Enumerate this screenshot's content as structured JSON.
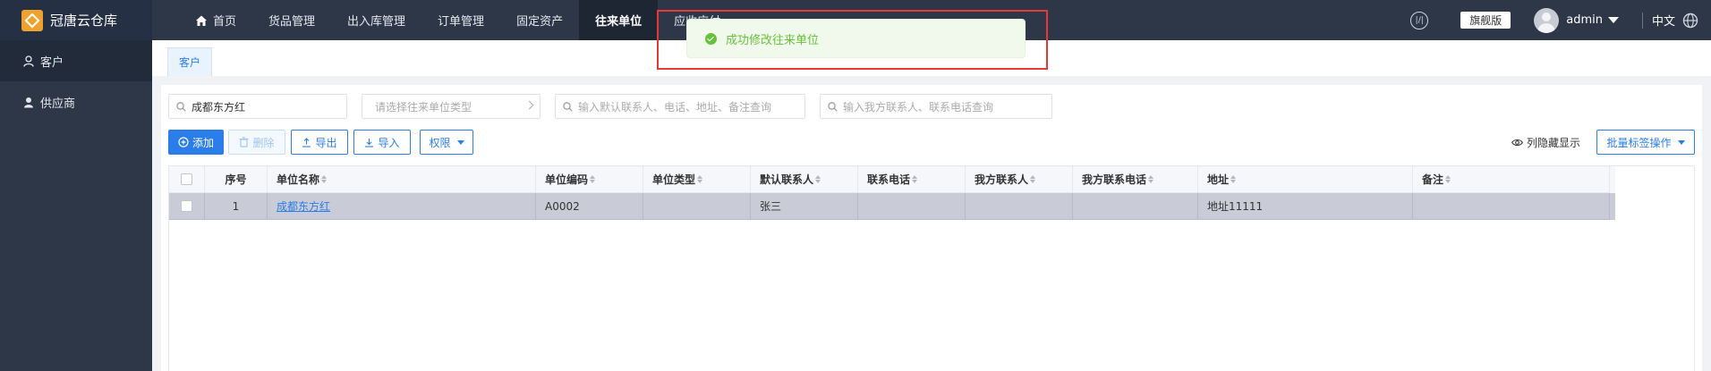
{
  "app": {
    "title": "冠唐云仓库"
  },
  "nav": {
    "items": [
      {
        "label": "首页",
        "icon": "home-icon"
      },
      {
        "label": "货品管理"
      },
      {
        "label": "出入库管理"
      },
      {
        "label": "订单管理"
      },
      {
        "label": "固定资产"
      },
      {
        "label": "往来单位",
        "active": true
      },
      {
        "label": "应收应付"
      }
    ]
  },
  "header": {
    "edition_badge": "旗舰版",
    "user_name": "admin",
    "language": "中文"
  },
  "sidebar": {
    "items": [
      {
        "label": "客户",
        "icon": "user-icon",
        "active": true
      },
      {
        "label": "供应商",
        "icon": "user-solid-icon"
      }
    ]
  },
  "tabs": [
    {
      "label": "客户"
    }
  ],
  "filters": {
    "name_value": "成都东方红",
    "type_placeholder": "请选择往来单位类型",
    "contact_placeholder": "输入默认联系人、电话、地址、备注查询",
    "our_contact_placeholder": "输入我方联系人、联系电话查询"
  },
  "toolbar": {
    "add_label": "添加",
    "delete_label": "删除",
    "export_label": "导出",
    "import_label": "导入",
    "permission_label": "权限",
    "column_hide_label": "列隐藏显示",
    "batch_tag_label": "批量标签操作"
  },
  "table": {
    "headers": [
      "序号",
      "单位名称",
      "单位编码",
      "单位类型",
      "默认联系人",
      "联系电话",
      "我方联系人",
      "我方联系电话",
      "地址",
      "备注"
    ],
    "rows": [
      {
        "index": "1",
        "name": "成都东方红",
        "code": "A0002",
        "type": "",
        "contact": "张三",
        "phone": "",
        "our_contact": "",
        "our_phone": "",
        "address": "地址11111",
        "remark": ""
      }
    ]
  },
  "toast": {
    "message": "成功修改往来单位",
    "color": "#67c23a"
  },
  "colors": {
    "accent": "#2b7de9",
    "topbar": "#2d3748",
    "highlight": "#e53935"
  }
}
